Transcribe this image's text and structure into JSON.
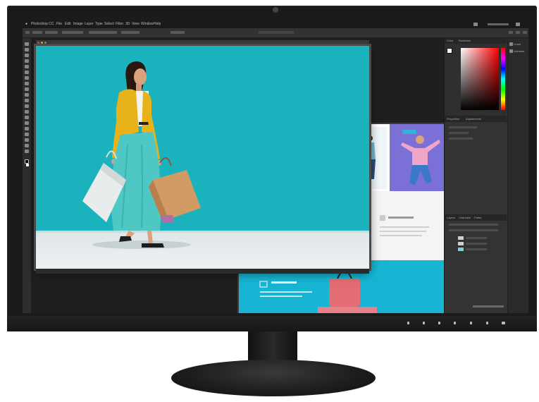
{
  "app": {
    "name": "Photoshop",
    "menu": [
      "Photoshop CC",
      "File",
      "Edit",
      "Image",
      "Layer",
      "Type",
      "Select",
      "Filter",
      "3D",
      "View",
      "Window",
      "Help"
    ]
  },
  "right_panel": {
    "tabs_top": [
      "Color",
      "Swatches"
    ],
    "tabs_mid": [
      "Properties",
      "Adjustments"
    ],
    "tabs_layers": [
      "Layers",
      "Channels",
      "Paths"
    ],
    "side": [
      "Learn",
      "Libraries"
    ]
  },
  "colors": {
    "canvas_teal": "#1ab3bd",
    "outfit_yellow": "#e8b21a",
    "skirt_teal": "#4fc7c4",
    "purple_photo": "#7a70d6",
    "page_cyan": "#17b5d3"
  }
}
